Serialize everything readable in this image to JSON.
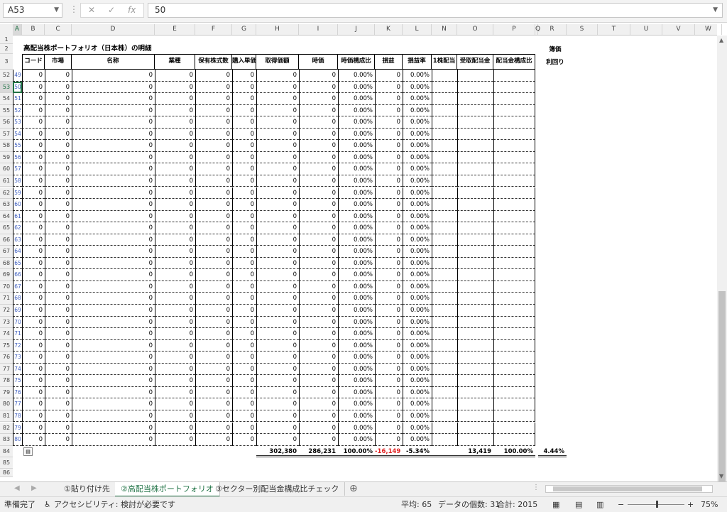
{
  "formula_bar": {
    "name_box": "A53",
    "cancel_icon": "✕",
    "enter_icon": "✓",
    "fx_label": "fx",
    "value": "50"
  },
  "columns": [
    "A",
    "B",
    "C",
    "D",
    "E",
    "F",
    "G",
    "H",
    "I",
    "J",
    "K",
    "L",
    "M",
    "N",
    "O",
    "P",
    "Q",
    "R",
    "S",
    "T",
    "U",
    "V",
    "W"
  ],
  "rows": {
    "top": [
      "1",
      "2",
      "3"
    ],
    "data": [
      "52",
      "53",
      "54",
      "55",
      "56",
      "57",
      "58",
      "59",
      "60",
      "61",
      "62",
      "63",
      "64",
      "65",
      "66",
      "67",
      "68",
      "69",
      "70",
      "71",
      "72",
      "73",
      "74",
      "75",
      "76",
      "77",
      "78",
      "79",
      "80",
      "81",
      "82",
      "83"
    ],
    "bottom": [
      "84",
      "85",
      "86"
    ]
  },
  "sheet": {
    "title": "高配当株ポートフォリオ（日本株）の明細",
    "headers": [
      "コード",
      "市場",
      "名称",
      "業種",
      "保有株式数",
      "購入単価",
      "取得価額",
      "時価",
      "時価構成比",
      "損益",
      "損益率",
      "1株配当",
      "受取配当金",
      "配当金構成比"
    ],
    "yield_header_1": "簿価",
    "yield_header_2": "利回り",
    "row_numbers": [
      "49",
      "50",
      "51",
      "52",
      "53",
      "54",
      "55",
      "56",
      "57",
      "58",
      "59",
      "60",
      "61",
      "62",
      "63",
      "64",
      "65",
      "66",
      "67",
      "68",
      "69",
      "70",
      "71",
      "72",
      "73",
      "74",
      "75",
      "76",
      "77",
      "78",
      "79",
      "80"
    ],
    "zero": "0",
    "zero_pct": "0.00%",
    "totals": {
      "acquisition": "302,380",
      "market_value": "286,231",
      "mv_ratio": "100.00%",
      "pnl": "-16,149",
      "pnl_rate": "-5.34%",
      "dividend": "13,419",
      "div_ratio": "100.00%",
      "yield": "4.44%"
    }
  },
  "tabs": [
    {
      "label": "①貼り付け先"
    },
    {
      "label": "②高配当株ポートフォリオ"
    },
    {
      "label": "③セクター別配当金構成比チェック"
    }
  ],
  "add_sheet_icon": "⊕",
  "status": {
    "ready": "準備完了",
    "accessibility": "アクセシビリティ: 検討が必要です",
    "average": "平均: 65",
    "count": "データの個数: 31",
    "sum": "合計: 2015",
    "zoom": "75%"
  },
  "colors": {
    "accent": "#217346",
    "negative": "#e02020",
    "link_blue": "#4060c0"
  }
}
